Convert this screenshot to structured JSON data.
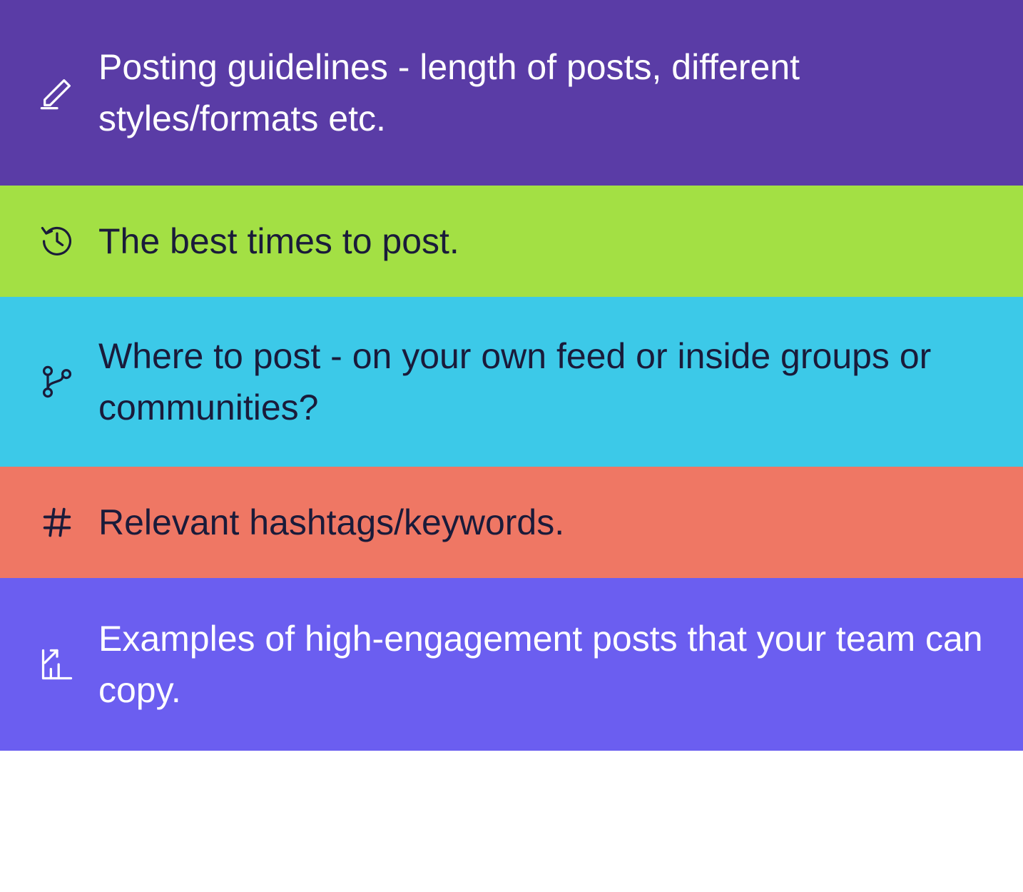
{
  "rows": [
    {
      "text": "Posting guidelines - length of posts, different styles/formats etc.",
      "icon": "edit-pencil-icon",
      "bg": "#5a3ca6",
      "text_color": "light"
    },
    {
      "text": "The best times to post.",
      "icon": "history-clock-icon",
      "bg": "#a3e044",
      "text_color": "dark"
    },
    {
      "text": "Where to post - on your own feed or inside groups or communities?",
      "icon": "branch-nodes-icon",
      "bg": "#3cc9e8",
      "text_color": "dark"
    },
    {
      "text": "Relevant hashtags/keywords.",
      "icon": "hashtag-icon",
      "bg": "#ef7764",
      "text_color": "dark"
    },
    {
      "text": "Examples of high-engagement posts that your team can copy.",
      "icon": "growth-chart-icon",
      "bg": "#6b5ef0",
      "text_color": "light"
    }
  ]
}
